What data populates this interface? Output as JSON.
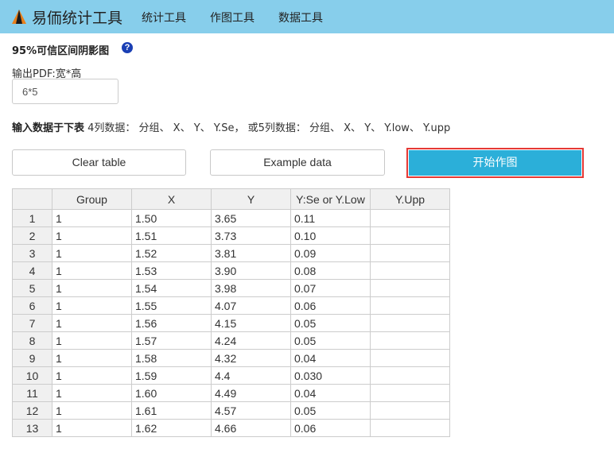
{
  "brand": {
    "name": "易侕统计工具",
    "logo_icon": "triangle-logo-icon"
  },
  "nav": [
    "统计工具",
    "作图工具",
    "数据工具"
  ],
  "section_title": "95%可信区间阴影图",
  "pdf": {
    "label": "输出PDF:宽*高",
    "value": "6*5"
  },
  "instructions": {
    "bold": "输入数据于下表",
    "rest": " 4列数据： 分组、 X、 Y、 Y.Se， 或5列数据： 分组、 X、 Y、 Y.low、 Y.upp"
  },
  "buttons": {
    "clear": "Clear table",
    "example": "Example data",
    "start": "开始作图"
  },
  "colors": {
    "navbar": "#87ceeb",
    "start_button": "#2bafd9",
    "highlight": "#e53935"
  },
  "table": {
    "headers": [
      "",
      "Group",
      "X",
      "Y",
      "Y:Se or Y.Low",
      "Y.Upp"
    ],
    "rows": [
      [
        "1",
        "1",
        "1.50",
        "3.65",
        "0.11",
        ""
      ],
      [
        "2",
        "1",
        "1.51",
        "3.73",
        "0.10",
        ""
      ],
      [
        "3",
        "1",
        "1.52",
        "3.81",
        "0.09",
        ""
      ],
      [
        "4",
        "1",
        "1.53",
        "3.90",
        "0.08",
        ""
      ],
      [
        "5",
        "1",
        "1.54",
        "3.98",
        "0.07",
        ""
      ],
      [
        "6",
        "1",
        "1.55",
        "4.07",
        "0.06",
        ""
      ],
      [
        "7",
        "1",
        "1.56",
        "4.15",
        "0.05",
        ""
      ],
      [
        "8",
        "1",
        "1.57",
        "4.24",
        "0.05",
        ""
      ],
      [
        "9",
        "1",
        "1.58",
        "4.32",
        "0.04",
        ""
      ],
      [
        "10",
        "1",
        "1.59",
        "4.4",
        "0.030",
        ""
      ],
      [
        "11",
        "1",
        "1.60",
        "4.49",
        "0.04",
        ""
      ],
      [
        "12",
        "1",
        "1.61",
        "4.57",
        "0.05",
        ""
      ],
      [
        "13",
        "1",
        "1.62",
        "4.66",
        "0.06",
        ""
      ]
    ]
  }
}
